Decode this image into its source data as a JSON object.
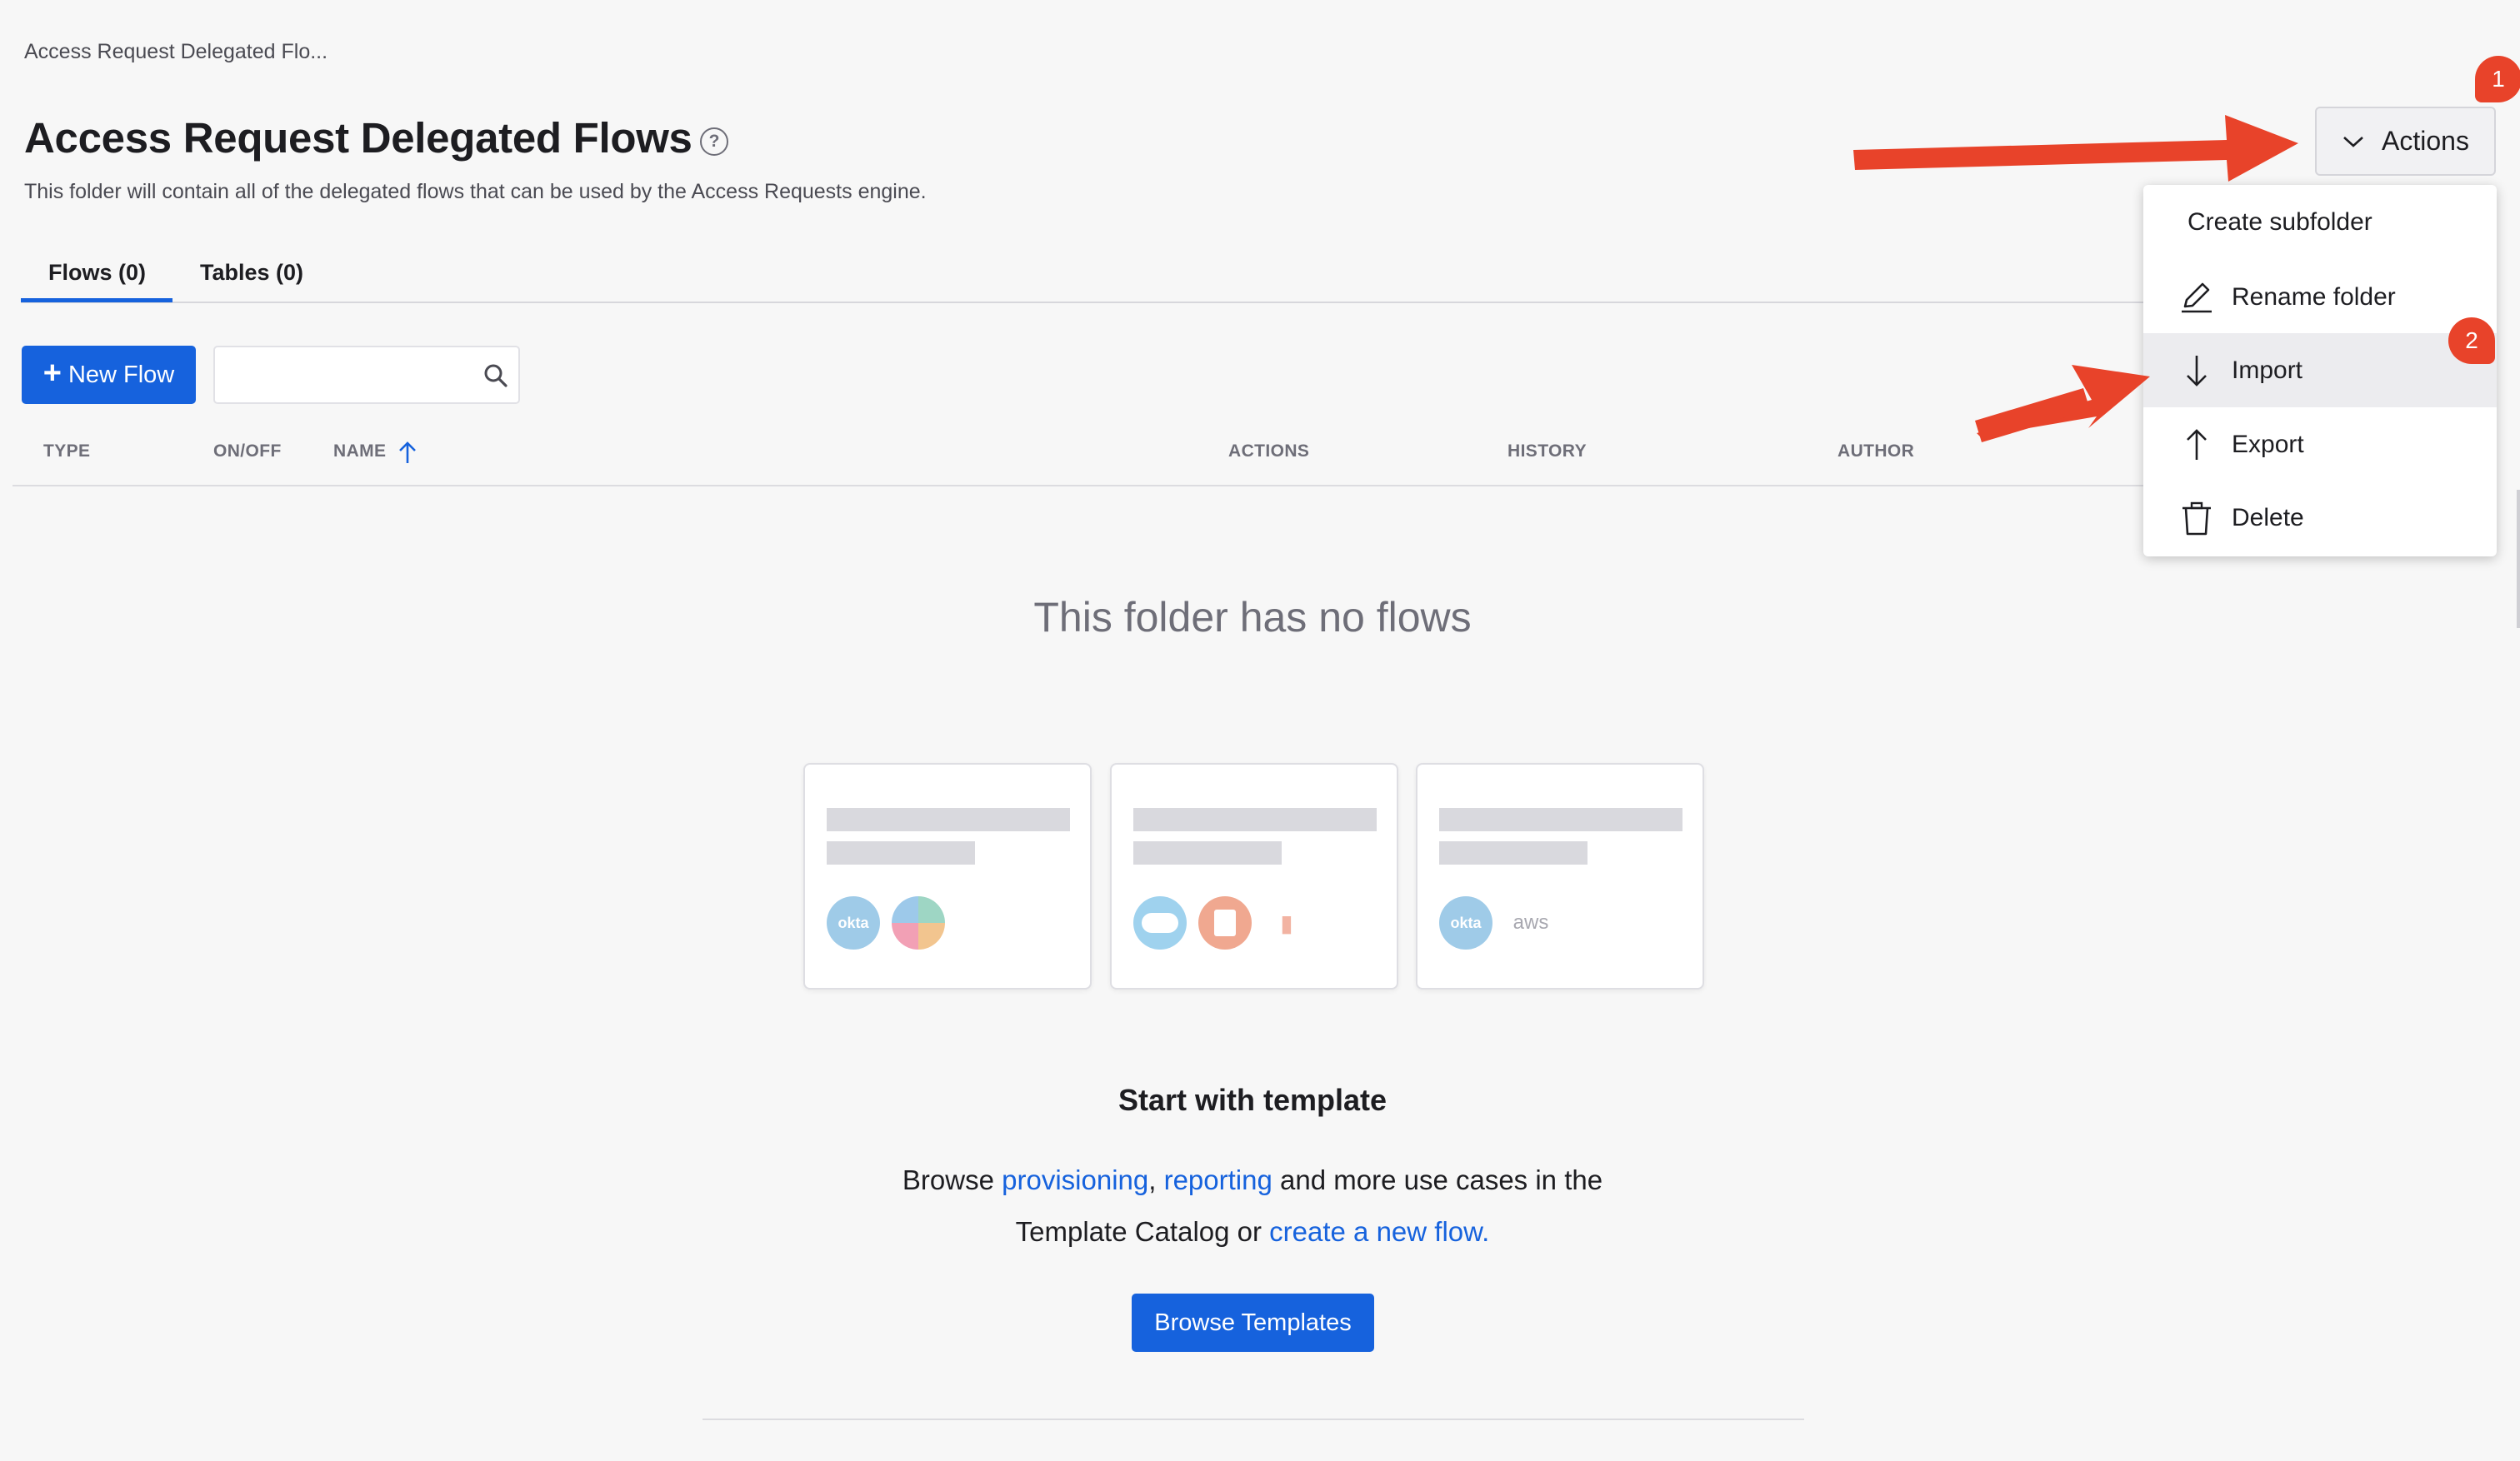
{
  "breadcrumb": "Access Request Delegated Flo...",
  "page": {
    "title": "Access Request Delegated Flows",
    "help_glyph": "?",
    "subtitle": "This folder will contain all of the delegated flows that can be used by the Access Requests engine."
  },
  "tabs": [
    {
      "label": "Flows (0)",
      "active": true
    },
    {
      "label": "Tables (0)",
      "active": false
    }
  ],
  "toolbar": {
    "new_flow_label": "New Flow",
    "search_placeholder": ""
  },
  "table": {
    "columns": [
      "TYPE",
      "ON/OFF",
      "NAME",
      "ACTIONS",
      "HISTORY",
      "AUTHOR"
    ],
    "sort_column": "NAME",
    "sort_direction": "ascending"
  },
  "empty_state": {
    "title": "This folder has no flows",
    "template_heading": "Start with template",
    "line1_prefix": "Browse ",
    "link_provisioning": "provisioning",
    "line1_comma": ", ",
    "link_reporting": "reporting",
    "line1_suffix": " and more use cases in the",
    "line2_prefix": "Template Catalog or ",
    "link_create": "create a new flow.",
    "browse_button": "Browse Templates",
    "cards": [
      {
        "logos": [
          "okta",
          "slack"
        ]
      },
      {
        "logos": [
          "salesforce",
          "office-365",
          "office-365-wordmark"
        ]
      },
      {
        "logos": [
          "okta",
          "aws"
        ]
      }
    ],
    "logo_text": {
      "okta": "okta",
      "aws": "aws"
    }
  },
  "actions_menu": {
    "button_label": "Actions",
    "items": [
      {
        "label": "Create subfolder",
        "icon": ""
      },
      {
        "label": "Rename folder",
        "icon": "pencil-icon"
      },
      {
        "label": "Import",
        "icon": "arrow-down-icon",
        "highlighted": true
      },
      {
        "label": "Export",
        "icon": "arrow-up-icon"
      },
      {
        "label": "Delete",
        "icon": "trash-icon"
      }
    ]
  },
  "callouts": [
    {
      "number": "1",
      "target": "Actions"
    },
    {
      "number": "2",
      "target": "Import"
    }
  ],
  "colors": {
    "primary": "#1662dd",
    "callout": "#e8432a",
    "background": "#f7f7f7"
  }
}
